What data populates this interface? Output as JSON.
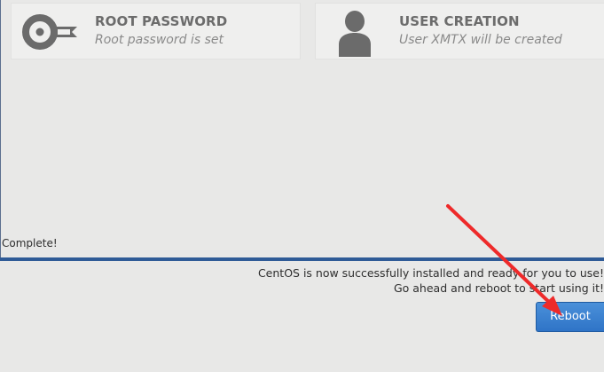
{
  "spokes": {
    "root_password": {
      "title": "ROOT PASSWORD",
      "status": "Root password is set",
      "icon": "key-icon"
    },
    "user_creation": {
      "title": "USER CREATION",
      "status": "User XMTX will be created",
      "icon": "user-icon"
    }
  },
  "progress": {
    "label": "Complete!",
    "fraction": 1.0
  },
  "message": {
    "line1": "CentOS is now successfully installed and ready for you to use!",
    "line2": "Go ahead and reboot to start using it!"
  },
  "actions": {
    "reboot_label": "Reboot"
  },
  "colors": {
    "background": "#e8e8e7",
    "progress_fill": "#2f5b97",
    "button_blue": "#3b82d1",
    "annotation_arrow": "#ee2a2a"
  }
}
